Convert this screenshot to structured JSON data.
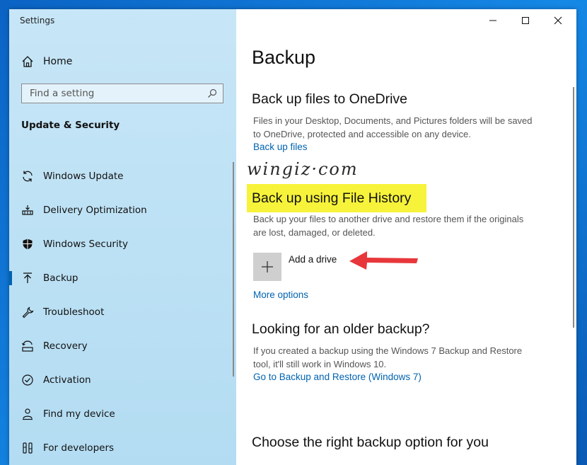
{
  "window": {
    "title": "Settings"
  },
  "sidebar": {
    "home_label": "Home",
    "search_placeholder": "Find a setting",
    "section_title": "Update & Security",
    "items": [
      {
        "label": "Windows Update",
        "icon": "sync-icon"
      },
      {
        "label": "Delivery Optimization",
        "icon": "delivery-optimization-icon"
      },
      {
        "label": "Windows Security",
        "icon": "shield-icon"
      },
      {
        "label": "Backup",
        "icon": "backup-arrow-icon",
        "selected": true
      },
      {
        "label": "Troubleshoot",
        "icon": "wrench-icon"
      },
      {
        "label": "Recovery",
        "icon": "recovery-icon"
      },
      {
        "label": "Activation",
        "icon": "check-circle-icon"
      },
      {
        "label": "Find my device",
        "icon": "person-location-icon"
      },
      {
        "label": "For developers",
        "icon": "developer-tools-icon"
      }
    ]
  },
  "main": {
    "page_title": "Backup",
    "onedrive": {
      "heading": "Back up files to OneDrive",
      "desc_line1": "Files in your Desktop, Documents, and Pictures folders will be saved",
      "desc_line2": "to OneDrive, protected and accessible on any device.",
      "link": "Back up files"
    },
    "watermark": "wingiz·com",
    "file_history": {
      "heading": "Back up using File History",
      "desc_line1": "Back up your files to another drive and restore them if the originals",
      "desc_line2": "are lost, damaged, or deleted.",
      "add_drive_label": "Add a drive",
      "more_options": "More options"
    },
    "older_backup": {
      "heading": "Looking for an older backup?",
      "desc_line1": "If you created a backup using the Windows 7 Backup and Restore",
      "desc_line2": "tool, it'll still work in Windows 10.",
      "link": "Go to Backup and Restore (Windows 7)"
    },
    "choose": {
      "heading": "Choose the right backup option for you"
    }
  },
  "colors": {
    "accent": "#0063b1",
    "highlight": "#f7f33a",
    "arrow": "#e8373b",
    "sidebar_bg": "#c7e6f7"
  }
}
